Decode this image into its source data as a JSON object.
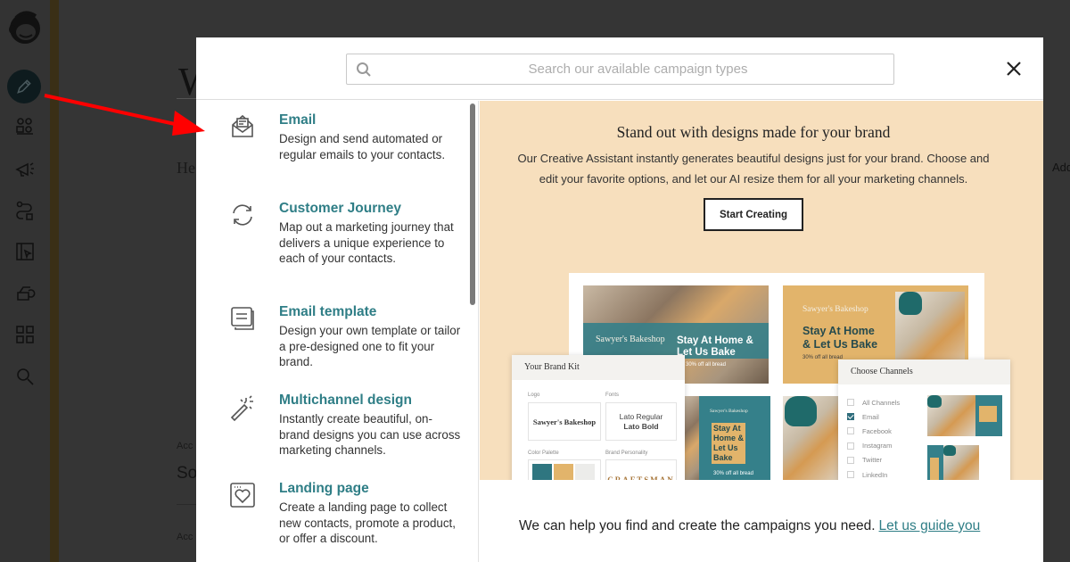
{
  "app": {
    "sidebar": {
      "items": [
        {
          "name": "mailchimp-logo",
          "icon": "freddie-logo"
        },
        {
          "name": "create",
          "icon": "pencil-icon",
          "active": true
        },
        {
          "name": "audience",
          "icon": "audience-icon"
        },
        {
          "name": "campaigns",
          "icon": "megaphone-icon"
        },
        {
          "name": "automations",
          "icon": "automation-path-icon"
        },
        {
          "name": "website",
          "icon": "website-cursor-icon"
        },
        {
          "name": "content-studio",
          "icon": "content-icon"
        },
        {
          "name": "integrations",
          "icon": "grid-icon"
        },
        {
          "name": "search",
          "icon": "search-icon"
        }
      ]
    },
    "background_page": {
      "title_fragment": "W",
      "subtitle_fragment": "He",
      "right_fragment": "Add",
      "account_label_1": "Acc",
      "account_value_1": "So",
      "account_label_2": "Acc"
    }
  },
  "modal": {
    "search": {
      "placeholder": "Search our available campaign types",
      "value": ""
    },
    "close_label": "×",
    "campaign_types": [
      {
        "title": "Email",
        "description": "Design and send automated or regular emails to your contacts.",
        "icon": "open-envelope-icon"
      },
      {
        "title": "Customer Journey",
        "description": "Map out a marketing journey that delivers a unique experience to each of your contacts.",
        "icon": "cycle-arrows-icon"
      },
      {
        "title": "Email template",
        "description": "Design your own template or tailor a pre-designed one to fit your brand.",
        "icon": "template-stack-icon"
      },
      {
        "title": "Multichannel design",
        "description": "Instantly create beautiful, on-brand designs you can use across marketing channels.",
        "icon": "magic-wand-icon"
      },
      {
        "title": "Landing page",
        "description": "Create a landing page to collect new contacts, promote a product, or offer a discount.",
        "icon": "landing-page-heart-icon"
      }
    ],
    "promo": {
      "title": "Stand out with designs made for your brand",
      "description": "Our Creative Assistant instantly generates beautiful designs just for your brand. Choose and edit your favorite options, and let our AI resize them for all your marketing channels.",
      "button_label": "Start Creating",
      "preview": {
        "bakery_brand": "Sawyer's Bakeshop",
        "headline": "Stay At Home & Let Us Bake",
        "headline_lines": [
          "Stay At Home",
          "& Let Us Bake"
        ],
        "headline_lines_split": [
          "Stay At Home &",
          "Let Us Bake"
        ],
        "square_headline_lines": [
          "Stay At",
          "Home &",
          "Let Us",
          "Bake"
        ],
        "offer": "30% off all bread",
        "brand_kit": {
          "title": "Your Brand Kit",
          "logo_label": "Logo",
          "logo_text": "Sawyer's Bakeshop",
          "fonts_label": "Fonts",
          "font_regular": "Lato Regular",
          "font_bold": "Lato Bold",
          "palette_label": "Color Palette",
          "palette": [
            "#2f7680",
            "#e2b46b",
            "#ececea",
            "#4b6b6b"
          ],
          "personality_label": "Brand Personality",
          "personality_value": "CRAFTSMAN"
        },
        "channels": {
          "title": "Choose Channels",
          "options": [
            {
              "label": "All Channels",
              "checked": false
            },
            {
              "label": "Email",
              "checked": true
            },
            {
              "label": "Facebook",
              "checked": false
            },
            {
              "label": "Instagram",
              "checked": false
            },
            {
              "label": "Twitter",
              "checked": false
            },
            {
              "label": "LinkedIn",
              "checked": false
            }
          ]
        }
      }
    },
    "footer": {
      "text": "We can help you find and create the campaigns you need.",
      "link_label": "Let us guide you"
    }
  },
  "colors": {
    "accent_teal": "#2f7e86",
    "promo_background": "#f7dfbd",
    "overlay": "#353535",
    "annotation_red": "#ff0000"
  }
}
